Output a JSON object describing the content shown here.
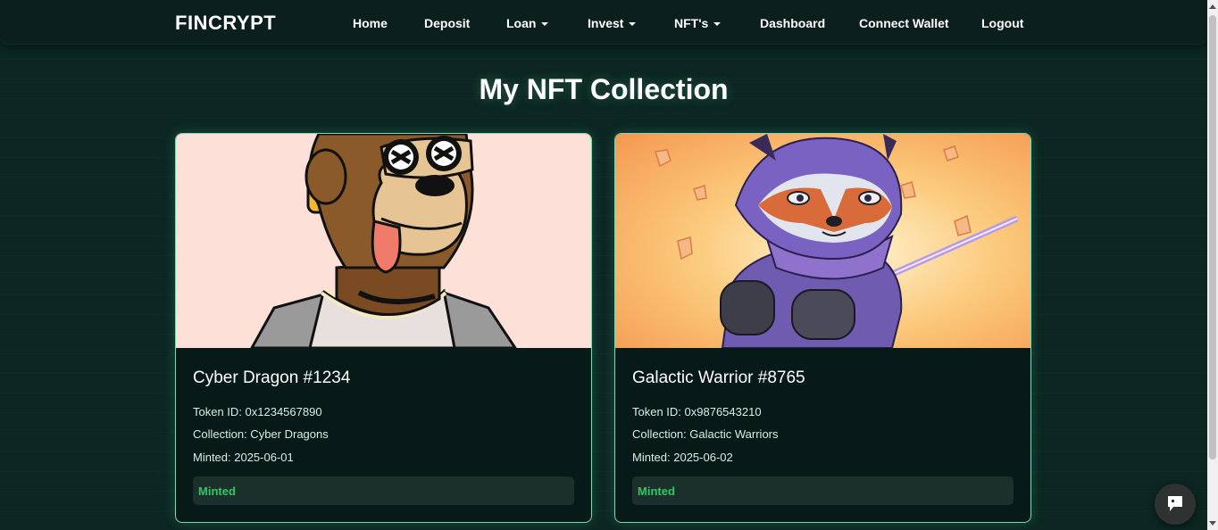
{
  "navbar": {
    "brand": "FINCRYPT",
    "items": [
      {
        "label": "Home",
        "dropdown": false
      },
      {
        "label": "Deposit",
        "dropdown": false
      },
      {
        "label": "Loan",
        "dropdown": true
      },
      {
        "label": "Invest",
        "dropdown": true
      },
      {
        "label": "NFT's",
        "dropdown": true
      },
      {
        "label": "Dashboard",
        "dropdown": false
      },
      {
        "label": "Connect Wallet",
        "dropdown": false
      },
      {
        "label": "Logout",
        "dropdown": false
      }
    ]
  },
  "page": {
    "title": "My NFT Collection"
  },
  "nfts": [
    {
      "name": "Cyber Dragon #1234",
      "token_line": "Token ID: 0x1234567890",
      "collection_line": "Collection: Cyber Dragons",
      "minted_line": "Minted: 2025-06-01",
      "status": "Minted",
      "image_icon": "ape-nft-image"
    },
    {
      "name": "Galactic Warrior #8765",
      "token_line": "Token ID: 0x9876543210",
      "collection_line": "Collection: Galactic Warriors",
      "minted_line": "Minted: 2025-06-02",
      "status": "Minted",
      "image_icon": "raccoon-ninja-nft-image"
    }
  ],
  "colors": {
    "background": "#0c2622",
    "navbar": "#0b1f1c",
    "card_background": "#071a17",
    "card_border": "#7fd6b0",
    "status_green": "#2ec866",
    "status_bar": "#1c302b"
  },
  "chat_widget": {
    "icon": "chat-icon"
  }
}
